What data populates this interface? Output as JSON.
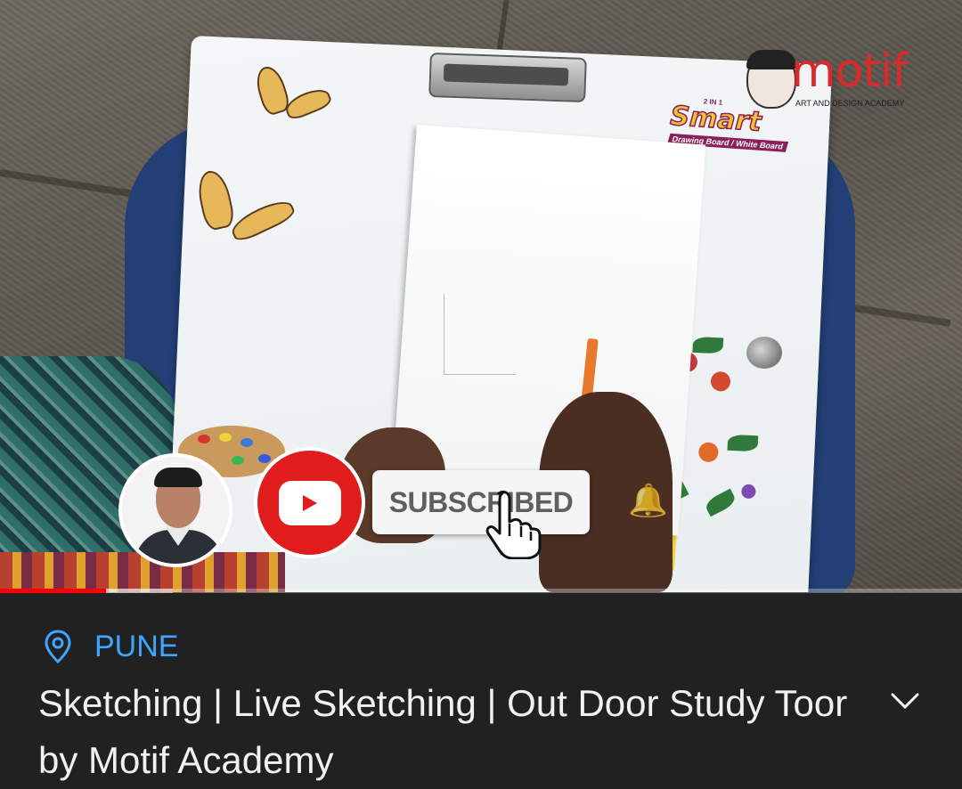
{
  "video": {
    "board_brand": {
      "top": "2 IN 1",
      "main": "Smart",
      "sub": "Drawing Board / White Board"
    },
    "watermark": {
      "text": "motif",
      "subtitle": "ART AND DESIGN ACADEMY"
    },
    "subscribe_label": "SUBSCRIBED",
    "progress_percent": 11,
    "buffered_percent": 18
  },
  "location": {
    "label": "PUNE",
    "icon": "location-pin-icon"
  },
  "title": "Sketching | Live Sketching | Out Door Study Toor by Motif Academy",
  "expand_icon": "chevron-down-icon",
  "colors": {
    "background": "#212121",
    "location": "#3ea6ff",
    "title": "#f1f1f1",
    "progress": "#ff0000",
    "youtube_red": "#e11c1c"
  }
}
